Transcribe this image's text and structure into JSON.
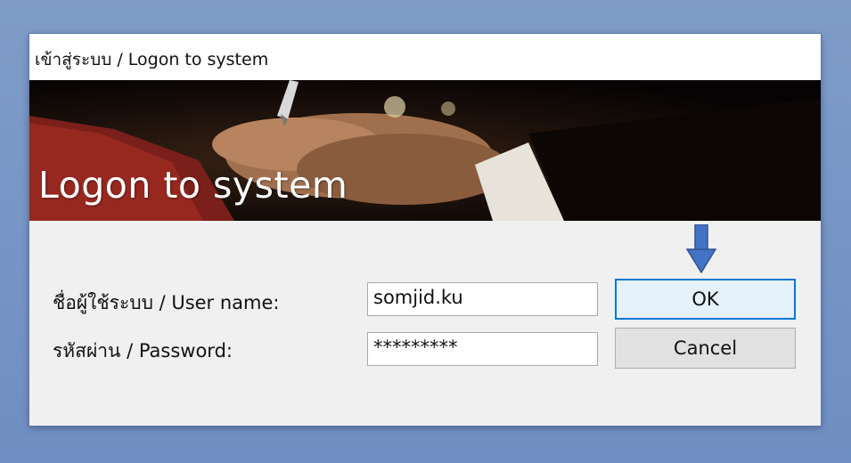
{
  "window": {
    "title": "เข้าสู่ระบบ / Logon to system"
  },
  "banner": {
    "title": "Logon to system"
  },
  "form": {
    "username_label": "ชื่อผู้ใช้ระบบ / User name:",
    "username_value": "somjid.ku",
    "password_label": "รหัสผ่าน / Password:",
    "password_value": "*********"
  },
  "buttons": {
    "ok": "OK",
    "cancel": "Cancel"
  },
  "colors": {
    "accent": "#0078d7",
    "arrow": "#4472c4",
    "background": "#7f9cc8"
  },
  "icons": {
    "pointer": "down-arrow-icon"
  }
}
